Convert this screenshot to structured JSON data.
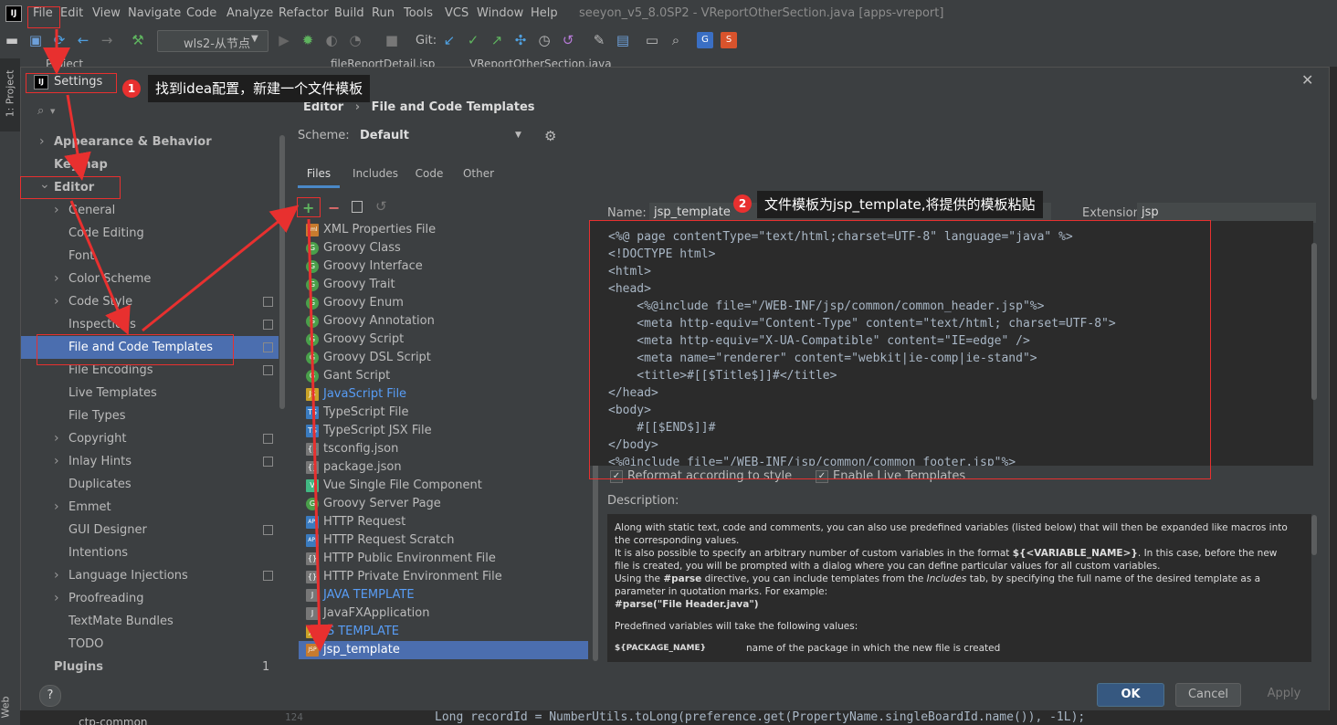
{
  "menu": {
    "items": [
      "File",
      "Edit",
      "View",
      "Navigate",
      "Code",
      "Analyze",
      "Refactor",
      "Build",
      "Run",
      "Tools",
      "VCS",
      "Window",
      "Help"
    ],
    "window_title": "seeyon_v5_8.0SP2 - VReportOtherSection.java [apps-vreport]"
  },
  "toolbar": {
    "run_config": "wls2-从节点",
    "git_label": "Git:"
  },
  "background": {
    "project_tab": "Project",
    "editor_tab_1": "fileReportDetail.jsp",
    "editor_tab_2": "VReportOtherSection.java",
    "side_label": "1: Project",
    "side_label_bottom": "Web",
    "bottom_code": "Long recordId = NumberUtils.toLong(preference.get(PropertyName.singleBoardId.name()), -1L);",
    "bottom_line_no": "124",
    "bottom_tree_item": "ctp-common"
  },
  "dialog": {
    "title": "Settings",
    "breadcrumb_parent": "Editor",
    "breadcrumb_sep": "›",
    "breadcrumb_current": "File and Code Templates",
    "scheme_label": "Scheme:",
    "scheme_value": "Default",
    "tabs": [
      "Files",
      "Includes",
      "Code",
      "Other"
    ],
    "name_label": "Name:",
    "name_value": "jsp_template",
    "extension_label": "Extension:",
    "extension_value": "jsp",
    "reformat_label": "Reformat according to style",
    "live_templates_label": "Enable Live Templates",
    "description_label": "Description:",
    "description": {
      "p1": "Along with static text, code and comments, you can also use predefined variables (listed below) that will then be expanded like macros into the corresponding values.",
      "p2a": "It is also possible to specify an arbitrary number of custom variables in the format ",
      "p2b": "${<VARIABLE_NAME>}",
      "p2c": ". In this case, before the new file is created, you will be prompted with a dialog where you can define particular values for all custom variables.",
      "p3a": "Using the ",
      "p3b": "#parse",
      "p3c": " directive, you can include templates from the ",
      "p3d": "Includes",
      "p3e": " tab, by specifying the full name of the desired template as a parameter in quotation marks. For example:",
      "p4": "#parse(\"File Header.java\")",
      "p5": "Predefined variables will take the following values:",
      "var_name": "${PACKAGE_NAME}",
      "var_desc": "name of the package in which the new file is created"
    },
    "buttons": {
      "ok": "OK",
      "cancel": "Cancel",
      "apply": "Apply",
      "help": "?"
    },
    "search_icon": "🔍"
  },
  "tree": [
    {
      "label": "Appearance & Behavior",
      "level": 0,
      "arrow": true,
      "bold": true
    },
    {
      "label": "Keymap",
      "level": 0,
      "arrow": false,
      "bold": true
    },
    {
      "label": "Editor",
      "level": 0,
      "arrow": true,
      "bold": true,
      "expanded": true
    },
    {
      "label": "General",
      "level": 1,
      "arrow": true
    },
    {
      "label": "Code Editing",
      "level": 1
    },
    {
      "label": "Font",
      "level": 1
    },
    {
      "label": "Color Scheme",
      "level": 1,
      "arrow": true
    },
    {
      "label": "Code Style",
      "level": 1,
      "arrow": true,
      "copy": true
    },
    {
      "label": "Inspections",
      "level": 1,
      "copy": true
    },
    {
      "label": "File and Code Templates",
      "level": 1,
      "copy": true,
      "selected": true
    },
    {
      "label": "File Encodings",
      "level": 1,
      "copy": true
    },
    {
      "label": "Live Templates",
      "level": 1
    },
    {
      "label": "File Types",
      "level": 1
    },
    {
      "label": "Copyright",
      "level": 1,
      "arrow": true,
      "copy": true
    },
    {
      "label": "Inlay Hints",
      "level": 1,
      "arrow": true,
      "copy": true
    },
    {
      "label": "Duplicates",
      "level": 1
    },
    {
      "label": "Emmet",
      "level": 1,
      "arrow": true
    },
    {
      "label": "GUI Designer",
      "level": 1,
      "copy": true
    },
    {
      "label": "Intentions",
      "level": 1
    },
    {
      "label": "Language Injections",
      "level": 1,
      "arrow": true,
      "copy": true
    },
    {
      "label": "Proofreading",
      "level": 1,
      "arrow": true
    },
    {
      "label": "TextMate Bundles",
      "level": 1
    },
    {
      "label": "TODO",
      "level": 1
    },
    {
      "label": "Plugins",
      "level": 0,
      "bold": true,
      "count": "1"
    }
  ],
  "templates": [
    {
      "label": "XML Properties File",
      "icon": "xml",
      "color": "#c77b2e"
    },
    {
      "label": "Groovy Class",
      "icon": "G",
      "color": "#4a9f4a"
    },
    {
      "label": "Groovy Interface",
      "icon": "G",
      "color": "#4a9f4a"
    },
    {
      "label": "Groovy Trait",
      "icon": "G",
      "color": "#4a9f4a"
    },
    {
      "label": "Groovy Enum",
      "icon": "G",
      "color": "#4a9f4a"
    },
    {
      "label": "Groovy Annotation",
      "icon": "G",
      "color": "#4a9f4a"
    },
    {
      "label": "Groovy Script",
      "icon": "G",
      "color": "#4a9f4a"
    },
    {
      "label": "Groovy DSL Script",
      "icon": "G",
      "color": "#4a9f4a"
    },
    {
      "label": "Gant Script",
      "icon": "G",
      "color": "#4a9f4a"
    },
    {
      "label": "JavaScript File",
      "icon": "JS",
      "color": "#c9a227",
      "blue": true
    },
    {
      "label": "TypeScript File",
      "icon": "TS",
      "color": "#3a7bbf"
    },
    {
      "label": "TypeScript JSX File",
      "icon": "TS",
      "color": "#3a7bbf"
    },
    {
      "label": "tsconfig.json",
      "icon": "{}",
      "color": "#777777"
    },
    {
      "label": "package.json",
      "icon": "{}",
      "color": "#777777"
    },
    {
      "label": "Vue Single File Component",
      "icon": "V",
      "color": "#41b883"
    },
    {
      "label": "Groovy Server Page",
      "icon": "G",
      "color": "#4a9f4a"
    },
    {
      "label": "HTTP Request",
      "icon": "API",
      "color": "#3a7bbf"
    },
    {
      "label": "HTTP Request Scratch",
      "icon": "API",
      "color": "#3a7bbf"
    },
    {
      "label": "HTTP Public Environment File",
      "icon": "{}",
      "color": "#777777"
    },
    {
      "label": "HTTP Private Environment File",
      "icon": "{}",
      "color": "#777777"
    },
    {
      "label": "JAVA TEMPLATE",
      "icon": "J",
      "color": "#777777",
      "blue": true
    },
    {
      "label": "JavaFXApplication",
      "icon": "J",
      "color": "#777777"
    },
    {
      "label": "JS TEMPLATE",
      "icon": "JS",
      "color": "#c9a227",
      "blue": true
    },
    {
      "label": "jsp_template",
      "icon": "JSP",
      "color": "#c77b2e",
      "selected": true
    }
  ],
  "code": [
    "<%@ page contentType=\"text/html;charset=UTF-8\" language=\"java\" %>",
    "<!DOCTYPE html>",
    "<html>",
    "<head>",
    "    <%@include file=\"/WEB-INF/jsp/common/common_header.jsp\"%>",
    "    <meta http-equiv=\"Content-Type\" content=\"text/html; charset=UTF-8\">",
    "    <meta http-equiv=\"X-UA-Compatible\" content=\"IE=edge\" />",
    "    <meta name=\"renderer\" content=\"webkit|ie-comp|ie-stand\">",
    "    <title>#[[$Title$]]#</title>",
    "</head>",
    "<body>",
    "    #[[$END$]]#",
    "</body>",
    "<%@include file=\"/WEB-INF/jsp/common/common_footer.jsp\"%>"
  ],
  "annotations": {
    "step1_num": "1",
    "step1_text": "找到idea配置，新建一个文件模板",
    "step2_num": "2",
    "step2_text": "文件模板为jsp_template,将提供的模板粘贴"
  },
  "colors": {
    "accent": "#4b6eaf",
    "annotation_red": "#e8302f",
    "ok_button": "#365880"
  }
}
